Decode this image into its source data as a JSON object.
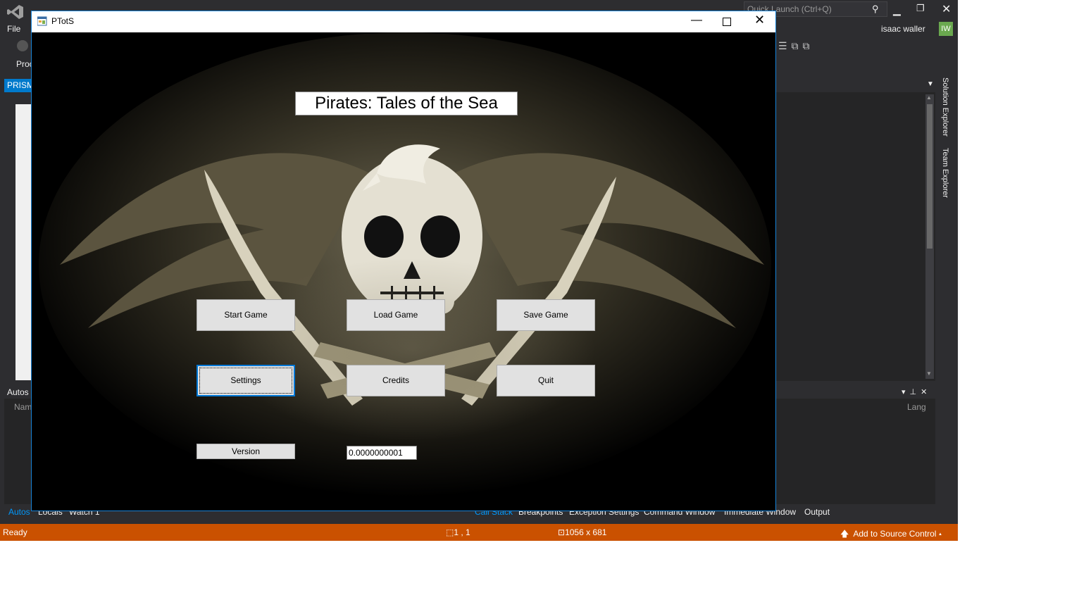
{
  "vs": {
    "menu_file": "File",
    "toolbar_prog": "Proc",
    "doc_tab": "PRISM",
    "autos_title": "Autos",
    "autos_name_col": "Nam",
    "quick_launch_placeholder": "Quick Launch (Ctrl+Q)",
    "user_name": "isaac waller",
    "user_initials": "IW",
    "side_tabs": [
      "Solution Explorer",
      "Team Explorer"
    ],
    "lang_col": "Lang",
    "bottom_tabs_left": [
      "Autos",
      "Locals",
      "Watch 1"
    ],
    "bottom_tabs_right": [
      "Call Stack",
      "Breakpoints",
      "Exception Settings",
      "Command Window",
      "Immediate Window",
      "Output"
    ],
    "status": {
      "ready": "Ready",
      "position": "1 , 1",
      "size": "1056 x 681",
      "source_control": "Add to Source Control"
    },
    "accent_color": "#007acc",
    "status_color": "#ca5100"
  },
  "app": {
    "window_title": "PTotS",
    "game_title": "Pirates: Tales of the Sea",
    "buttons": {
      "start": "Start Game",
      "load": "Load Game",
      "save": "Save Game",
      "settings": "Settings",
      "credits": "Credits",
      "quit": "Quit"
    },
    "version_label": "Version",
    "version_value": "0.0000000001",
    "focused_button": "settings"
  }
}
